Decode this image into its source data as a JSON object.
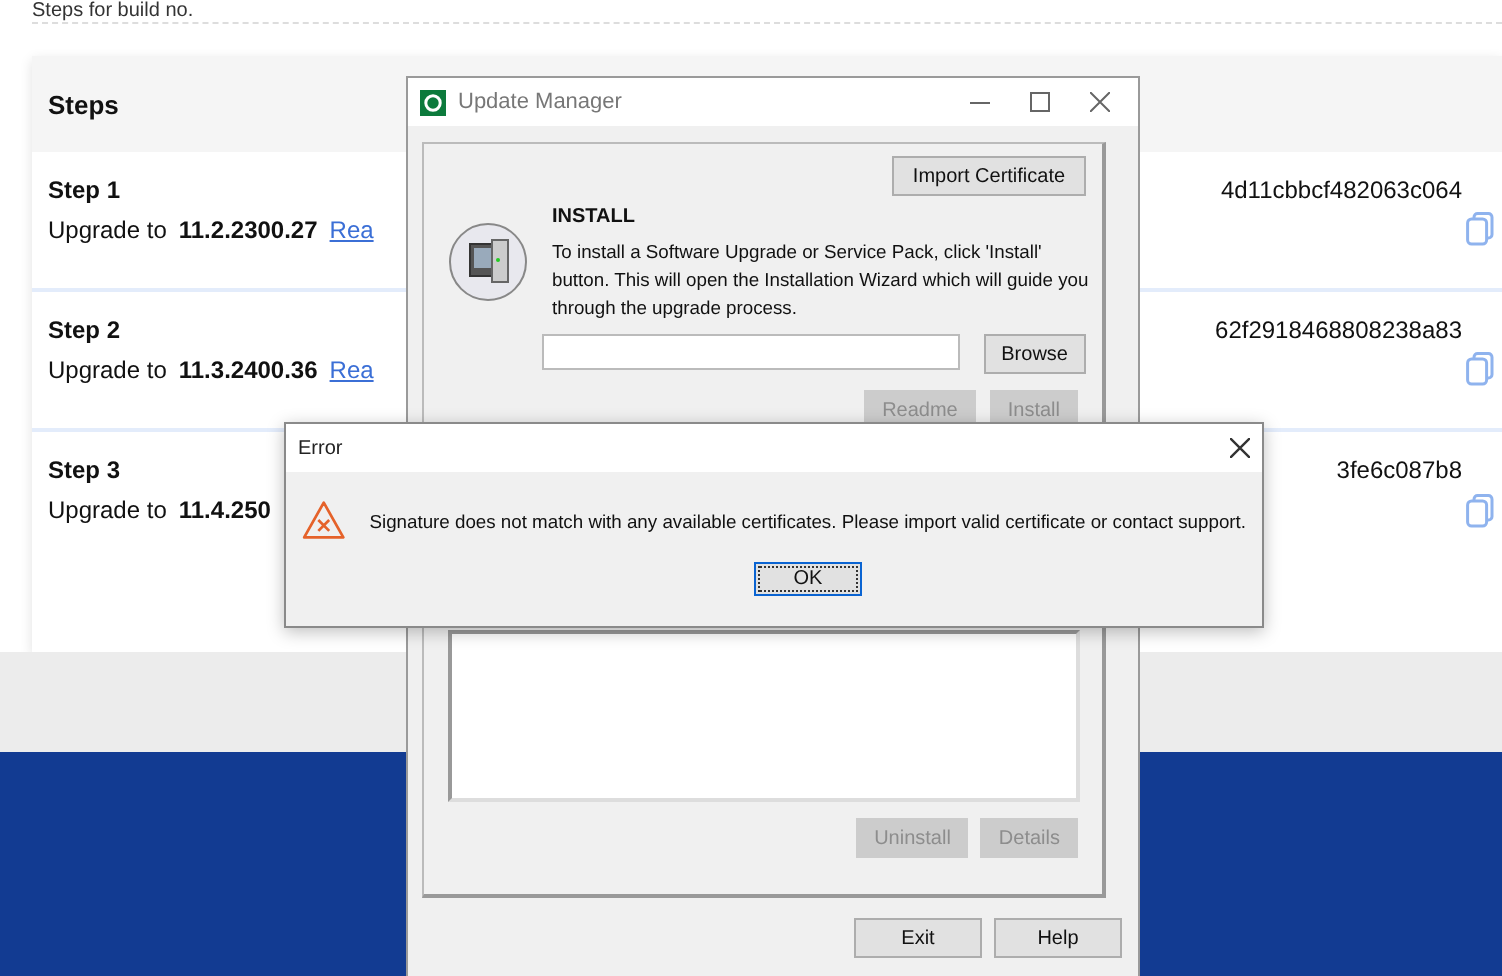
{
  "page": {
    "build_label": "Steps for build no.",
    "steps_header": "Steps",
    "steps": [
      {
        "title": "Step 1",
        "upgrade_label": "Upgrade to",
        "version": "11.2.2300.27",
        "link": "Rea",
        "hash": "4d11cbbcf482063c064"
      },
      {
        "title": "Step 2",
        "upgrade_label": "Upgrade to",
        "version": "11.3.2400.36",
        "link": "Rea",
        "hash": "62f2918468808238a83"
      },
      {
        "title": "Step 3",
        "upgrade_label": "Upgrade to",
        "version": "11.4.250",
        "hash": "3fe6c087b8"
      }
    ]
  },
  "update_manager": {
    "title": "Update Manager",
    "import_button": {
      "label": "Import Certificate",
      "disabled": false
    },
    "install_heading": "INSTALL",
    "install_text": "To install a Software Upgrade or Service Pack, click 'Install' button. This will open the Installation Wizard which will guide you through the upgrade process.",
    "browse_button": {
      "label": "Browse",
      "disabled": false
    },
    "install_buttons": [
      {
        "label": "Readme",
        "disabled": true
      },
      {
        "label": "Install",
        "disabled": true
      }
    ],
    "uninstall_buttons": [
      {
        "label": "Uninstall",
        "disabled": true
      },
      {
        "label": "Details",
        "disabled": true
      }
    ],
    "footer_buttons": [
      {
        "label": "Exit",
        "disabled": false
      },
      {
        "label": "Help",
        "disabled": false
      }
    ]
  },
  "error_dialog": {
    "title": "Error",
    "message": "Signature does not match with any available certificates. Please import valid certificate or contact support.",
    "ok_button": {
      "label": "OK",
      "focused": true
    }
  }
}
